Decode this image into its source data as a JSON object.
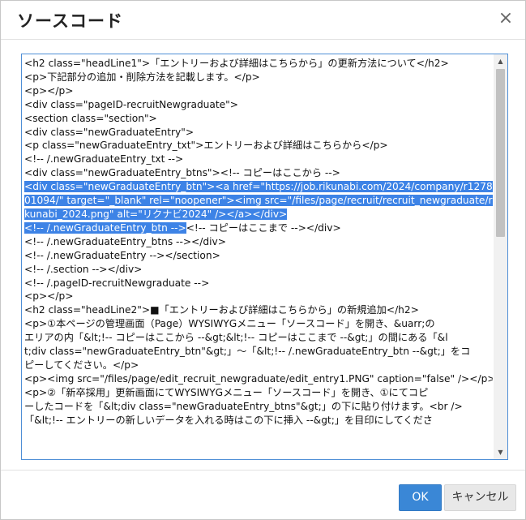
{
  "dialog": {
    "title": "ソースコード",
    "close_glyph": "×",
    "ok_label": "OK",
    "cancel_label": "キャンセル"
  },
  "editor": {
    "lines": [
      {
        "pre": "<h2 class=\"headLine1\">「エントリーおよび詳細はこちらから」の更新方法について</h2>",
        "sel": "",
        "post": ""
      },
      {
        "pre": "<p>下記部分の追加・削除方法を記載します。</p>",
        "sel": "",
        "post": ""
      },
      {
        "pre": "<p></p>",
        "sel": "",
        "post": ""
      },
      {
        "pre": "<div class=\"pageID-recruitNewgraduate\">",
        "sel": "",
        "post": ""
      },
      {
        "pre": "<section class=\"section\">",
        "sel": "",
        "post": ""
      },
      {
        "pre": "<div class=\"newGraduateEntry\">",
        "sel": "",
        "post": ""
      },
      {
        "pre": "<p class=\"newGraduateEntry_txt\">エントリーおよび詳細はこちらから</p>",
        "sel": "",
        "post": ""
      },
      {
        "pre": "<!-- /.newGraduateEntry_txt -->",
        "sel": "",
        "post": ""
      },
      {
        "pre": "<div class=\"newGraduateEntry_btns\"><!-- コピーはここから -->",
        "sel": "",
        "post": ""
      },
      {
        "pre": "",
        "sel": "<div class=\"newGraduateEntry_btn\"><a href=\"https://job.rikunabi.com/2024/company/r1278",
        "post": ""
      },
      {
        "pre": "",
        "sel": "01094/\" target=\"_blank\" rel=\"noopener\"><img src=\"/files/page/recruit/recruit_newgraduate/ri",
        "post": ""
      },
      {
        "pre": "",
        "sel": "kunabi_2024.png\" alt=\"リクナビ2024\" /></a></div>",
        "post": ""
      },
      {
        "pre": "",
        "sel": "<!-- /.newGraduateEntry_btn -->",
        "post": "<!-- コピーはここまで --></div>"
      },
      {
        "pre": "<!-- /.newGraduateEntry_btns --></div>",
        "sel": "",
        "post": ""
      },
      {
        "pre": "<!-- /.newGraduateEntry --></section>",
        "sel": "",
        "post": ""
      },
      {
        "pre": "<!-- /.section --></div>",
        "sel": "",
        "post": ""
      },
      {
        "pre": "<!-- /.pageID-recruitNewgraduate -->",
        "sel": "",
        "post": ""
      },
      {
        "pre": "<p></p>",
        "sel": "",
        "post": ""
      },
      {
        "pre": "<h2 class=\"headLine2\">■「エントリーおよび詳細はこちらから」の新規追加</h2>",
        "sel": "",
        "post": ""
      },
      {
        "pre": "<p>①本ページの管理画面（Page）WYSIWYGメニュー「ソースコード」を開き、&uarr;の",
        "sel": "",
        "post": ""
      },
      {
        "pre": "エリアの内「&lt;!-- コピーはここから --&gt;&lt;!-- コピーはここまで --&gt;」の間にある「&l",
        "sel": "",
        "post": ""
      },
      {
        "pre": "t;div class=\"newGraduateEntry_btn\"&gt;」～「&lt;!-- /.newGraduateEntry_btn --&gt;」をコ",
        "sel": "",
        "post": ""
      },
      {
        "pre": "ピーしてください。</p>",
        "sel": "",
        "post": ""
      },
      {
        "pre": "<p><img src=\"/files/page/edit_recruit_newgraduate/edit_entry1.PNG\" caption=\"false\" /></p>",
        "sel": "",
        "post": ""
      },
      {
        "pre": "<p>②「新卒採用」更新画面にてWYSIWYGメニュー「ソースコード」を開き、①にてコピ",
        "sel": "",
        "post": ""
      },
      {
        "pre": "ーしたコードを「&lt;div class=\"newGraduateEntry_btns\"&gt;」の下に貼り付けます。<br />",
        "sel": "",
        "post": ""
      },
      {
        "pre": "「&lt;!-- エントリーの新しいデータを入れる時はこの下に挿入 --&gt;」を目印にしてくださ",
        "sel": "",
        "post": ""
      }
    ]
  },
  "scrollbar": {
    "up_glyph": "▲",
    "down_glyph": "▼",
    "position": 0.0
  },
  "colors": {
    "selection": "#3d83e6",
    "ok_button": "#3a87d6",
    "editor_border": "#4f8fd6"
  }
}
